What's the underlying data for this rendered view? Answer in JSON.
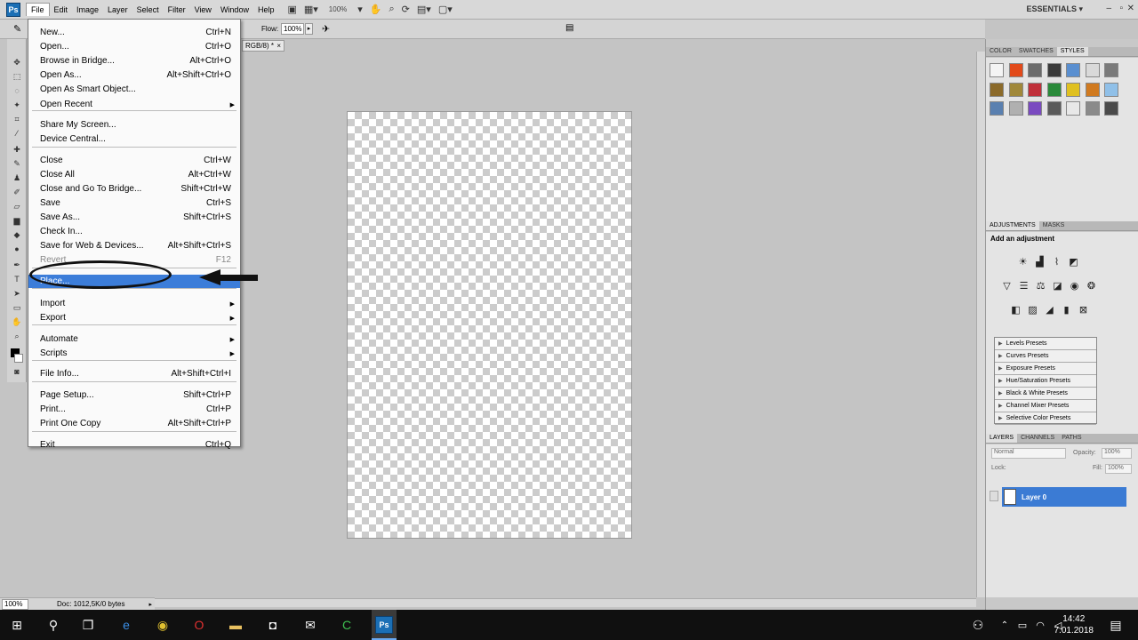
{
  "menubar": {
    "logo": "Ps",
    "items": [
      "File",
      "Edit",
      "Image",
      "Layer",
      "Select",
      "Filter",
      "View",
      "Window",
      "Help"
    ],
    "zoom": "100%",
    "workspace": "ESSENTIALS"
  },
  "options": {
    "flow_label": "Flow:",
    "flow_value": "100%"
  },
  "document_tab": {
    "title": "RGB/8) *",
    "close": "×"
  },
  "file_menu": {
    "items": [
      {
        "label": "New...",
        "shortcut": "Ctrl+N"
      },
      {
        "label": "Open...",
        "shortcut": "Ctrl+O"
      },
      {
        "label": "Browse in Bridge...",
        "shortcut": "Alt+Ctrl+O"
      },
      {
        "label": "Open As...",
        "shortcut": "Alt+Shift+Ctrl+O"
      },
      {
        "label": "Open As Smart Object...",
        "shortcut": ""
      },
      {
        "label": "Open Recent",
        "shortcut": ""
      },
      {
        "label": "Share My Screen...",
        "shortcut": ""
      },
      {
        "label": "Device Central...",
        "shortcut": ""
      },
      {
        "label": "Close",
        "shortcut": "Ctrl+W"
      },
      {
        "label": "Close All",
        "shortcut": "Alt+Ctrl+W"
      },
      {
        "label": "Close and Go To Bridge...",
        "shortcut": "Shift+Ctrl+W"
      },
      {
        "label": "Save",
        "shortcut": "Ctrl+S"
      },
      {
        "label": "Save As...",
        "shortcut": "Shift+Ctrl+S"
      },
      {
        "label": "Check In...",
        "shortcut": ""
      },
      {
        "label": "Save for Web & Devices...",
        "shortcut": "Alt+Shift+Ctrl+S"
      },
      {
        "label": "Revert",
        "shortcut": "F12"
      },
      {
        "label": "Place...",
        "shortcut": ""
      },
      {
        "label": "Import",
        "shortcut": ""
      },
      {
        "label": "Export",
        "shortcut": ""
      },
      {
        "label": "Automate",
        "shortcut": ""
      },
      {
        "label": "Scripts",
        "shortcut": ""
      },
      {
        "label": "File Info...",
        "shortcut": "Alt+Shift+Ctrl+I"
      },
      {
        "label": "Page Setup...",
        "shortcut": "Shift+Ctrl+P"
      },
      {
        "label": "Print...",
        "shortcut": "Ctrl+P"
      },
      {
        "label": "Print One Copy",
        "shortcut": "Alt+Shift+Ctrl+P"
      },
      {
        "label": "Exit",
        "shortcut": "Ctrl+Q"
      }
    ]
  },
  "styles_panel": {
    "tabs": [
      "COLOR",
      "SWATCHES",
      "STYLES"
    ],
    "swatches": [
      "#f4f4f4",
      "#e24a1a",
      "#6b6b6b",
      "#3a3a3a",
      "#5a8fd0",
      "#d9d9d9",
      "#7a7a7a",
      "#8b6a2a",
      "#a0883a",
      "#c0303a",
      "#2a8a3a",
      "#e0c020",
      "#d07a20",
      "#90c0e8",
      "#5a80b0",
      "#b0b0b0",
      "#7a4ac0",
      "#5a5a5a",
      "#e8e8e8",
      "#8a8a8a",
      "#4a4a4a"
    ]
  },
  "adjustments_panel": {
    "tabs": [
      "ADJUSTMENTS",
      "MASKS"
    ],
    "title": "Add an adjustment",
    "presets": [
      "Levels Presets",
      "Curves Presets",
      "Exposure Presets",
      "Hue/Saturation Presets",
      "Black & White Presets",
      "Channel Mixer Presets",
      "Selective Color Presets"
    ]
  },
  "layers_panel": {
    "tabs": [
      "LAYERS",
      "CHANNELS",
      "PATHS"
    ],
    "blend_mode": "Normal",
    "opacity_label": "Opacity:",
    "opacity_value": "100%",
    "lock_label": "Lock:",
    "fill_label": "Fill:",
    "fill_value": "100%",
    "layer_name": "Layer 0"
  },
  "status": {
    "zoom": "100%",
    "doc_info": "Doc: 1012,5K/0 bytes"
  },
  "taskbar": {
    "time": "14:42",
    "date": "7.01.2018"
  }
}
